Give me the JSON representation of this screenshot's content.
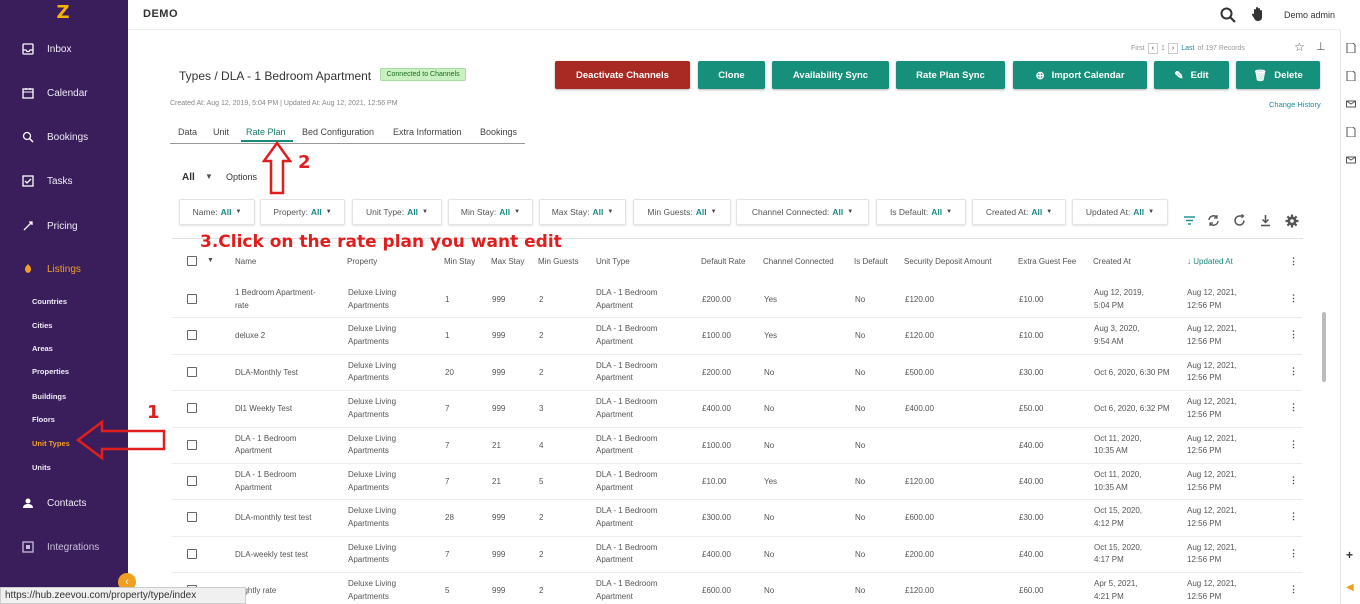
{
  "topbar": {
    "company": "DEMO",
    "user": "Demo admin"
  },
  "sidebar": {
    "items": [
      {
        "label": "Inbox",
        "icon": "inbox-icon"
      },
      {
        "label": "Calendar",
        "icon": "calendar-icon"
      },
      {
        "label": "Bookings",
        "icon": "bookings-icon"
      },
      {
        "label": "Tasks",
        "icon": "tasks-icon"
      },
      {
        "label": "Pricing",
        "icon": "pricing-icon"
      },
      {
        "label": "Listings",
        "icon": "listings-icon"
      },
      {
        "label": "Contacts",
        "icon": "contacts-icon"
      },
      {
        "label": "Integrations",
        "icon": "integrations-icon"
      }
    ],
    "subitems": [
      "Countries",
      "Cities",
      "Areas",
      "Properties",
      "Buildings",
      "Floors",
      "Unit Types",
      "Units"
    ],
    "active_sub": "Unit Types"
  },
  "header": {
    "breadcrumb_root": "Types",
    "separator": "/",
    "title": "DLA - 1 Bedroom Apartment",
    "badge": "Connected to Channels",
    "created": "Created At: Aug 12, 2019, 5:04 PM",
    "updated": "Updated At: Aug 12, 2021, 12:56 PM",
    "change_history": "Change History"
  },
  "pager": {
    "first": "First",
    "page": "1",
    "last": "Last",
    "records": "of 197 Records"
  },
  "buttons": {
    "deactivate": "Deactivate Channels",
    "clone": "Clone",
    "availability": "Availability Sync",
    "rateplan": "Rate Plan Sync",
    "import": "Import Calendar",
    "edit": "Edit",
    "delete": "Delete"
  },
  "tabs": [
    "Data",
    "Unit",
    "Rate Plan",
    "Bed Configuration",
    "Extra Information",
    "Bookings"
  ],
  "active_tab": "Rate Plan",
  "view": {
    "selected": "All",
    "options": "Options"
  },
  "filters": [
    {
      "label": "Name:",
      "value": "All"
    },
    {
      "label": "Property:",
      "value": "All"
    },
    {
      "label": "Unit Type:",
      "value": "All"
    },
    {
      "label": "Min Stay:",
      "value": "All"
    },
    {
      "label": "Max Stay:",
      "value": "All"
    },
    {
      "label": "Min Guests:",
      "value": "All"
    },
    {
      "label": "Channel Connected:",
      "value": "All"
    },
    {
      "label": "Is Default:",
      "value": "All"
    },
    {
      "label": "Created At:",
      "value": "All"
    },
    {
      "label": "Updated At:",
      "value": "All"
    }
  ],
  "columns": [
    "Name",
    "Property",
    "Min Stay",
    "Max Stay",
    "Min Guests",
    "Unit Type",
    "Default Rate",
    "Channel Connected",
    "Is Default",
    "Security Deposit Amount",
    "Extra Guest Fee",
    "Created At",
    "↓ Updated At"
  ],
  "rows": [
    {
      "name": [
        "1 Bedroom Apartment-",
        "rate"
      ],
      "property": [
        "Deluxe Living",
        "Apartments"
      ],
      "min_stay": "1",
      "max_stay": "999",
      "min_guests": "2",
      "unit_type": [
        "DLA - 1 Bedroom",
        "Apartment"
      ],
      "rate": "£200.00",
      "channel": "Yes",
      "is_default": "No",
      "deposit": "£120.00",
      "extra_fee": "£10.00",
      "created": [
        "Aug 12, 2019,",
        "5:04 PM"
      ],
      "updated": [
        "Aug 12, 2021,",
        "12:56 PM"
      ]
    },
    {
      "name": [
        "deluxe 2"
      ],
      "property": [
        "Deluxe Living",
        "Apartments"
      ],
      "min_stay": "1",
      "max_stay": "999",
      "min_guests": "2",
      "unit_type": [
        "DLA - 1 Bedroom",
        "Apartment"
      ],
      "rate": "£100.00",
      "channel": "Yes",
      "is_default": "No",
      "deposit": "£120.00",
      "extra_fee": "£10.00",
      "created": [
        "Aug 3, 2020,",
        "9:54 AM"
      ],
      "updated": [
        "Aug 12, 2021,",
        "12:56 PM"
      ]
    },
    {
      "name": [
        "DLA-Monthly Test"
      ],
      "property": [
        "Deluxe Living",
        "Apartments"
      ],
      "min_stay": "20",
      "max_stay": "999",
      "min_guests": "2",
      "unit_type": [
        "DLA - 1 Bedroom",
        "Apartment"
      ],
      "rate": "£200.00",
      "channel": "No",
      "is_default": "No",
      "deposit": "£500.00",
      "extra_fee": "£30.00",
      "created": [
        "Oct 6, 2020, 6:30 PM"
      ],
      "updated": [
        "Aug 12, 2021,",
        "12:56 PM"
      ]
    },
    {
      "name": [
        "Dl1 Weekly Test"
      ],
      "property": [
        "Deluxe Living",
        "Apartments"
      ],
      "min_stay": "7",
      "max_stay": "999",
      "min_guests": "3",
      "unit_type": [
        "DLA - 1 Bedroom",
        "Apartment"
      ],
      "rate": "£400.00",
      "channel": "No",
      "is_default": "No",
      "deposit": "£400.00",
      "extra_fee": "£50.00",
      "created": [
        "Oct 6, 2020, 6:32 PM"
      ],
      "updated": [
        "Aug 12, 2021,",
        "12:56 PM"
      ]
    },
    {
      "name": [
        "DLA - 1 Bedroom",
        "Apartment"
      ],
      "property": [
        "Deluxe Living",
        "Apartments"
      ],
      "min_stay": "7",
      "max_stay": "21",
      "min_guests": "4",
      "unit_type": [
        "DLA - 1 Bedroom",
        "Apartment"
      ],
      "rate": "£100.00",
      "channel": "No",
      "is_default": "No",
      "deposit": "",
      "extra_fee": "£40.00",
      "created": [
        "Oct 11, 2020,",
        "10:35 AM"
      ],
      "updated": [
        "Aug 12, 2021,",
        "12:56 PM"
      ]
    },
    {
      "name": [
        "DLA - 1 Bedroom",
        "Apartment"
      ],
      "property": [
        "Deluxe Living",
        "Apartments"
      ],
      "min_stay": "7",
      "max_stay": "21",
      "min_guests": "5",
      "unit_type": [
        "DLA - 1 Bedroom",
        "Apartment"
      ],
      "rate": "£10.00",
      "channel": "Yes",
      "is_default": "No",
      "deposit": "£120.00",
      "extra_fee": "£40.00",
      "created": [
        "Oct 11, 2020,",
        "10:35 AM"
      ],
      "updated": [
        "Aug 12, 2021,",
        "12:56 PM"
      ]
    },
    {
      "name": [
        "DLA-monthly test test"
      ],
      "property": [
        "Deluxe Living",
        "Apartments"
      ],
      "min_stay": "28",
      "max_stay": "999",
      "min_guests": "2",
      "unit_type": [
        "DLA - 1 Bedroom",
        "Apartment"
      ],
      "rate": "£300.00",
      "channel": "No",
      "is_default": "No",
      "deposit": "£600.00",
      "extra_fee": "£30.00",
      "created": [
        "Oct 15, 2020,",
        "4:12 PM"
      ],
      "updated": [
        "Aug 12, 2021,",
        "12:56 PM"
      ]
    },
    {
      "name": [
        "DLA-weekly test test"
      ],
      "property": [
        "Deluxe Living",
        "Apartments"
      ],
      "min_stay": "7",
      "max_stay": "999",
      "min_guests": "2",
      "unit_type": [
        "DLA - 1 Bedroom",
        "Apartment"
      ],
      "rate": "£400.00",
      "channel": "No",
      "is_default": "No",
      "deposit": "£200.00",
      "extra_fee": "£40.00",
      "created": [
        "Oct 15, 2020,",
        "4:17 PM"
      ],
      "updated": [
        "Aug 12, 2021,",
        "12:56 PM"
      ]
    },
    {
      "name": [
        "...ightly rate"
      ],
      "property": [
        "Deluxe Living",
        "Apartments"
      ],
      "min_stay": "5",
      "max_stay": "999",
      "min_guests": "2",
      "unit_type": [
        "DLA - 1 Bedroom",
        "Apartment"
      ],
      "rate": "£600.00",
      "channel": "No",
      "is_default": "No",
      "deposit": "£120.00",
      "extra_fee": "£60.00",
      "created": [
        "Apr 5, 2021,",
        "4:21 PM"
      ],
      "updated": [
        "Aug 12, 2021,",
        "12:56 PM"
      ]
    }
  ],
  "annotations": {
    "step1": "1",
    "step2": "2",
    "step3": "3.Click on the rate plan you want edit"
  },
  "status_url": "https://hub.zeevou.com/property/type/index",
  "colors": {
    "sidebar": "#3a1e5c",
    "accent": "#f0a020",
    "teal": "#16907a",
    "danger": "#a82a22",
    "annotation": "#e01e1e"
  }
}
